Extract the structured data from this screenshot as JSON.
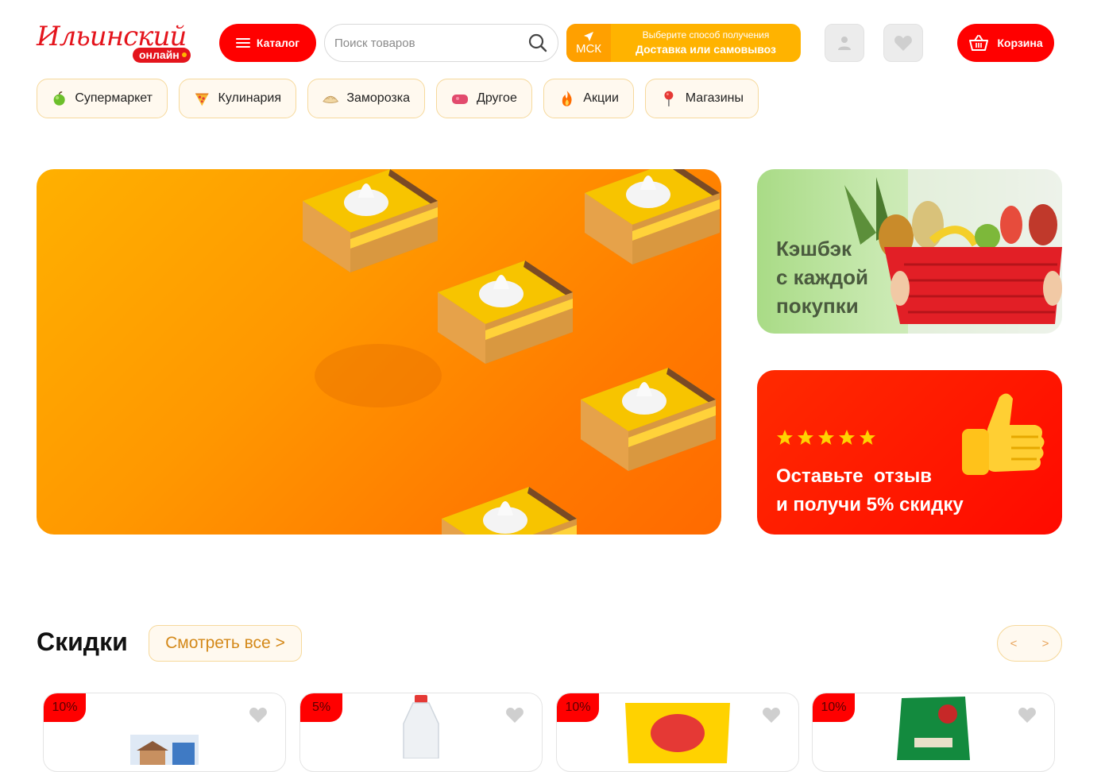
{
  "brand": {
    "logo_main": "Ильинский",
    "logo_sub": "онлайн"
  },
  "header": {
    "catalog_label": "Каталог",
    "search_placeholder": "Поиск товаров",
    "delivery": {
      "city": "МСК",
      "line1": "Выберите способ получения",
      "line2": "Доставка или самовывоз"
    },
    "cart_label": "Корзина"
  },
  "categories": [
    {
      "label": "Супермаркет",
      "icon": "apple-icon"
    },
    {
      "label": "Кулинария",
      "icon": "pizza-icon"
    },
    {
      "label": "Заморозка",
      "icon": "dumpling-icon"
    },
    {
      "label": "Другое",
      "icon": "soap-icon"
    },
    {
      "label": "Акции",
      "icon": "fire-icon"
    },
    {
      "label": "Магазины",
      "icon": "pin-icon"
    }
  ],
  "banners": {
    "cashback": {
      "line1": "Кэшбэк",
      "line2": "с каждой",
      "line3": "покупки"
    },
    "review": {
      "line1": "Оставьте  отзыв",
      "line2": "и получи 5% скидку",
      "stars": 5
    }
  },
  "discounts": {
    "title": "Скидки",
    "see_all": "Смотреть все >",
    "prev": "<",
    "next": ">",
    "products": [
      {
        "discount": "10%",
        "image": "milk-carton"
      },
      {
        "discount": "5%",
        "image": "water-bottle"
      },
      {
        "discount": "10%",
        "image": "lays-chips"
      },
      {
        "discount": "10%",
        "image": "tea-pack"
      }
    ]
  },
  "colors": {
    "brand_red": "#ff0000",
    "delivery_orange": "#ffb300",
    "chip_border": "#f6d99c"
  }
}
